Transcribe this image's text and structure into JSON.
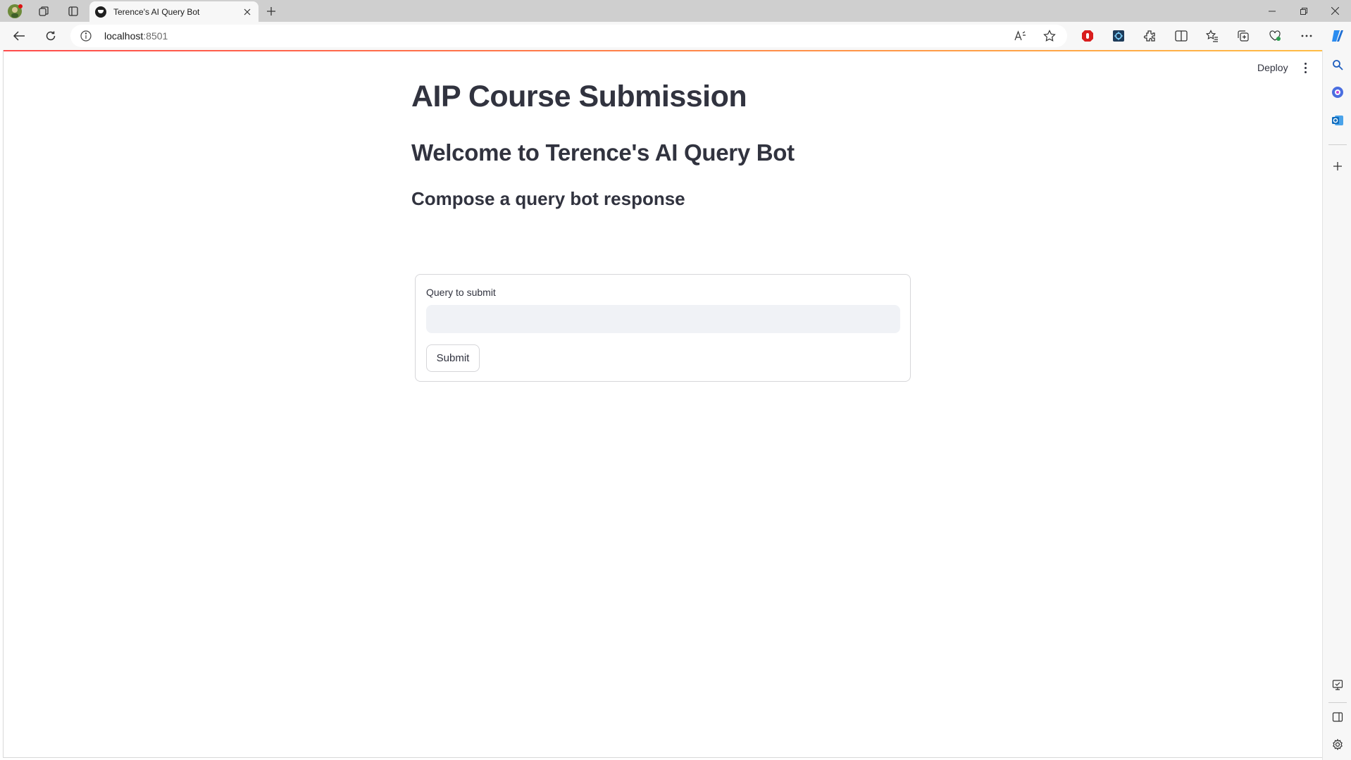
{
  "browser": {
    "tab": {
      "title": "Terence's AI Query Bot"
    },
    "address_bar": {
      "host": "localhost",
      "port": ":8501"
    },
    "icons": [
      "profile-avatar",
      "workspaces-icon",
      "tab-actions-icon",
      "close-icon",
      "new-tab-icon",
      "minimize-icon",
      "restore-icon",
      "close-window-icon",
      "back-icon",
      "refresh-icon",
      "site-info-icon",
      "read-aloud-icon",
      "favorite-star-icon",
      "extension-red-icon",
      "extension-blue-icon",
      "extensions-icon",
      "split-screen-icon",
      "favorites-icon",
      "collections-icon",
      "performance-icon",
      "more-icon",
      "copilot-icon",
      "search-icon",
      "discover-icon",
      "outlook-icon",
      "add-icon",
      "screenshot-icon",
      "sidebar-toggle-icon",
      "settings-icon"
    ]
  },
  "app": {
    "header": {
      "deploy_label": "Deploy"
    },
    "title": "AIP Course Submission",
    "subheader": "Welcome to Terence's AI Query Bot",
    "section_heading": "Compose a query bot response",
    "form": {
      "input_label": "Query to submit",
      "input_value": "",
      "submit_label": "Submit"
    },
    "colors": {
      "accent_red": "#ff4b4b",
      "accent_yellow": "#ffbd45",
      "text": "#31333f",
      "input_bg": "#f0f2f6"
    }
  }
}
